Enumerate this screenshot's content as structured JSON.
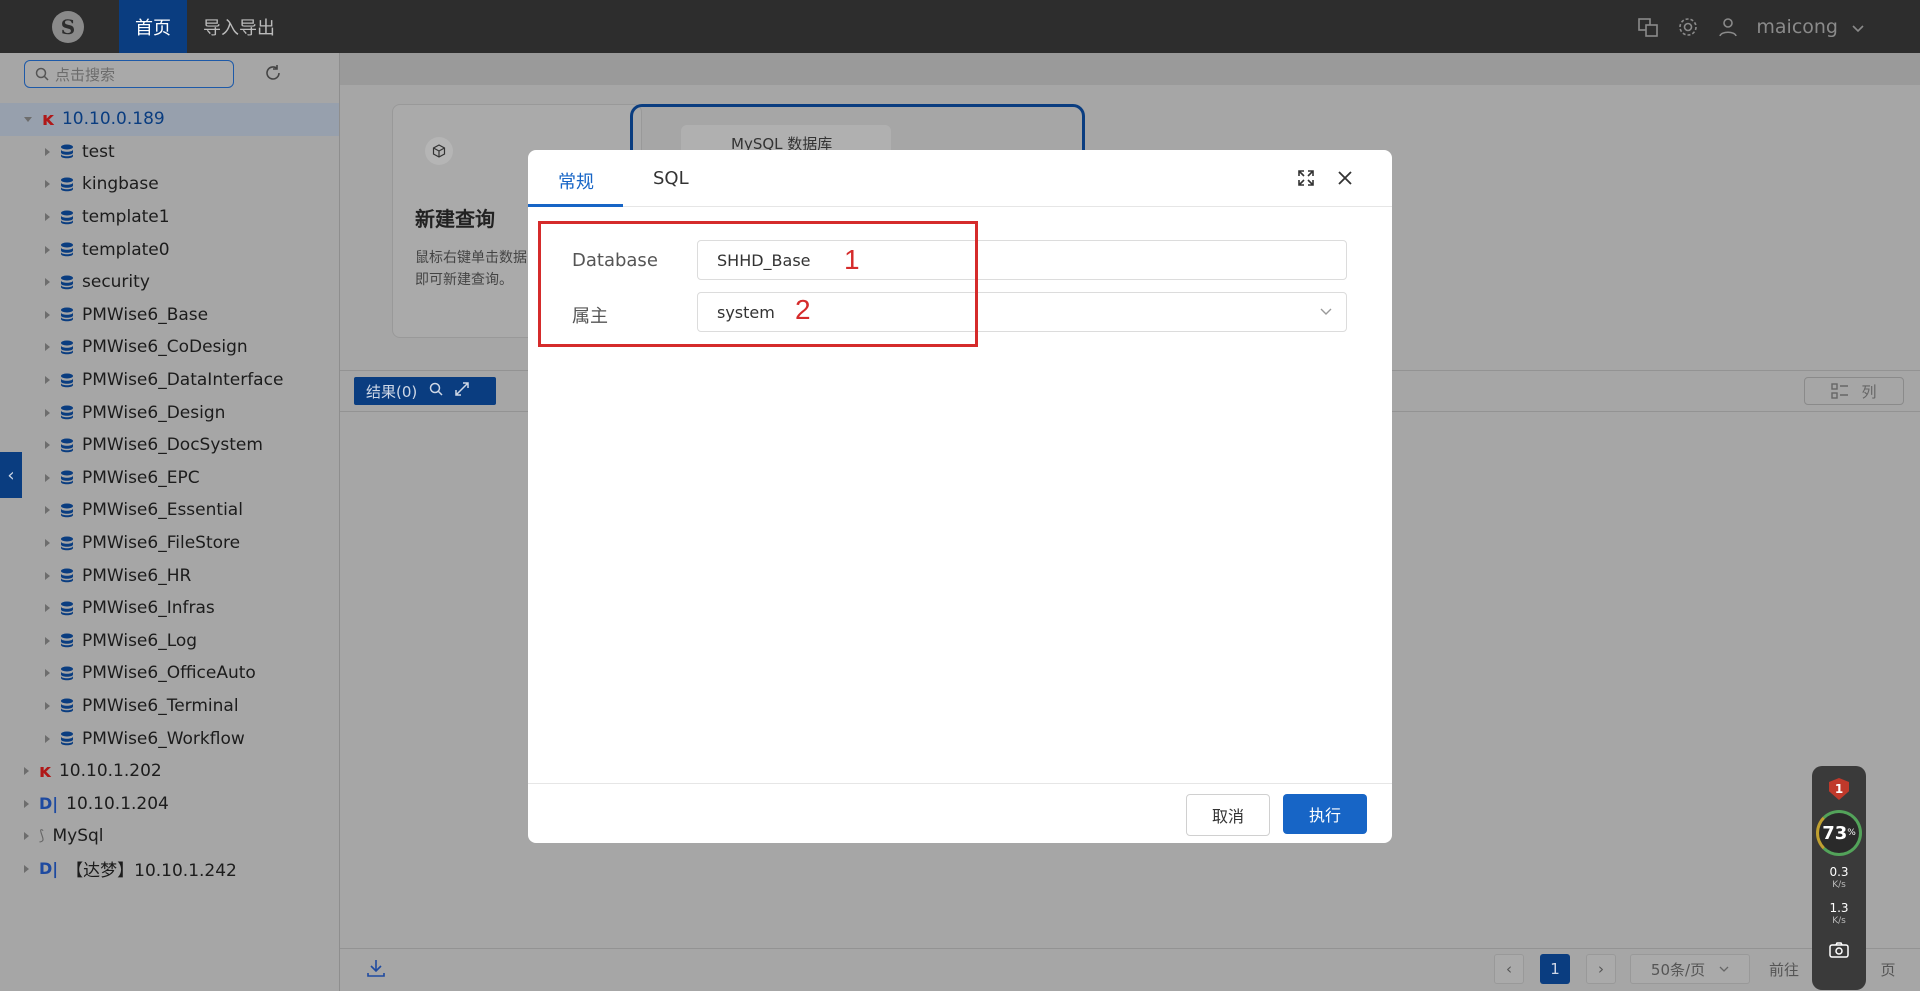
{
  "topbar": {
    "logo_glyph": "S",
    "tabs": [
      {
        "label": "首页"
      },
      {
        "label": "导入导出"
      }
    ],
    "username": "maicong"
  },
  "sidebar": {
    "search_placeholder": "点击搜索",
    "tree": [
      {
        "label": "10.10.0.189",
        "icon": "kingbase-icon",
        "expanded": true
      },
      {
        "label": "test",
        "icon": "database-icon"
      },
      {
        "label": "kingbase",
        "icon": "database-icon"
      },
      {
        "label": "template1",
        "icon": "database-icon"
      },
      {
        "label": "template0",
        "icon": "database-icon"
      },
      {
        "label": "security",
        "icon": "database-icon"
      },
      {
        "label": "PMWise6_Base",
        "icon": "database-icon"
      },
      {
        "label": "PMWise6_CoDesign",
        "icon": "database-icon"
      },
      {
        "label": "PMWise6_DataInterface",
        "icon": "database-icon"
      },
      {
        "label": "PMWise6_Design",
        "icon": "database-icon"
      },
      {
        "label": "PMWise6_DocSystem",
        "icon": "database-icon"
      },
      {
        "label": "PMWise6_EPC",
        "icon": "database-icon"
      },
      {
        "label": "PMWise6_Essential",
        "icon": "database-icon"
      },
      {
        "label": "PMWise6_FileStore",
        "icon": "database-icon"
      },
      {
        "label": "PMWise6_HR",
        "icon": "database-icon"
      },
      {
        "label": "PMWise6_Infras",
        "icon": "database-icon"
      },
      {
        "label": "PMWise6_Log",
        "icon": "database-icon"
      },
      {
        "label": "PMWise6_OfficeAuto",
        "icon": "database-icon"
      },
      {
        "label": "PMWise6_Terminal",
        "icon": "database-icon"
      },
      {
        "label": "PMWise6_Workflow",
        "icon": "database-icon"
      },
      {
        "label": "10.10.1.202",
        "icon": "kingbase-icon"
      },
      {
        "label": "10.10.1.204",
        "icon": "dameng-icon"
      },
      {
        "label": "MySql",
        "icon": "mysql-icon"
      },
      {
        "label": "【达梦】10.10.1.242",
        "icon": "dameng-icon"
      }
    ]
  },
  "main": {
    "card_title": "新建查询",
    "card_desc_line1": "鼠标右键单击数据",
    "card_desc_line2": "即可新建查询。",
    "card2_label": "MySQL 数据库",
    "result_label": "结果(0)",
    "col_label": "列",
    "pager": {
      "current": "1",
      "page_size": "50条/页",
      "goto": "前往",
      "page_suffix": "页"
    }
  },
  "widget": {
    "alert_count": "1",
    "cpu": "73",
    "cpu_unit": "%",
    "up": "0.3",
    "up_unit": "K/s",
    "down": "1.3",
    "down_unit": "K/s"
  },
  "modal": {
    "tabs": [
      {
        "label": "常规"
      },
      {
        "label": "SQL"
      }
    ],
    "fields": [
      {
        "label": "Database",
        "value": "SHHD_Base",
        "annotation": "1"
      },
      {
        "label": "属主",
        "value": "system",
        "annotation": "2"
      }
    ],
    "cancel": "取消",
    "ok": "执行"
  },
  "colors": {
    "accent": "#1765c6",
    "annotation": "#d52b2b",
    "nav_active": "#0a3d80"
  }
}
